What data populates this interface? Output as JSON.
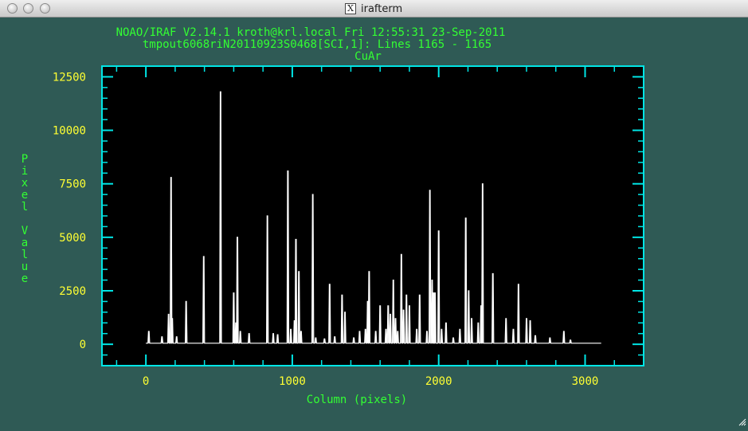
{
  "window": {
    "title": "irafterm",
    "x_icon_glyph": "X"
  },
  "plot": {
    "header_line1": "NOAO/IRAF V2.14.1 kroth@krl.local Fri 12:55:31 23-Sep-2011",
    "header_line2": "tmpout6068riN20110923S0468[SCI,1]: Lines 1165 - 1165",
    "title": "CuAr"
  },
  "colors": {
    "background": "#2f5a55",
    "plot_bg": "#000000",
    "axis": "#00e5e5",
    "label_text": "#33ff33",
    "tick_text": "#ffff33",
    "trace": "#ffffff"
  },
  "chart_data": {
    "type": "line",
    "title": "CuAr",
    "xlabel": "Column (pixels)",
    "ylabel": "Pixel Value",
    "xlim": [
      -300,
      3400
    ],
    "ylim": [
      -1000,
      13000
    ],
    "x_ticks": [
      0,
      1000,
      2000,
      3000
    ],
    "y_ticks": [
      0,
      2500,
      5000,
      7500,
      10000,
      12500
    ],
    "x_tick_labels": [
      "0",
      "1000",
      "2000",
      "3000"
    ],
    "y_tick_labels": [
      "0",
      "2500",
      "5000",
      "7500",
      "10000",
      "12500"
    ],
    "x_range": [
      0,
      3110
    ],
    "baseline": 50,
    "peaks": [
      {
        "x": 20,
        "y": 600
      },
      {
        "x": 110,
        "y": 350
      },
      {
        "x": 155,
        "y": 1400
      },
      {
        "x": 172,
        "y": 7800
      },
      {
        "x": 180,
        "y": 1200
      },
      {
        "x": 210,
        "y": 350
      },
      {
        "x": 275,
        "y": 2000
      },
      {
        "x": 395,
        "y": 4100
      },
      {
        "x": 510,
        "y": 11800
      },
      {
        "x": 600,
        "y": 2400
      },
      {
        "x": 615,
        "y": 1000
      },
      {
        "x": 625,
        "y": 5000
      },
      {
        "x": 645,
        "y": 600
      },
      {
        "x": 705,
        "y": 500
      },
      {
        "x": 830,
        "y": 6000
      },
      {
        "x": 870,
        "y": 500
      },
      {
        "x": 900,
        "y": 450
      },
      {
        "x": 970,
        "y": 8100
      },
      {
        "x": 990,
        "y": 700
      },
      {
        "x": 1015,
        "y": 1100
      },
      {
        "x": 1025,
        "y": 4900
      },
      {
        "x": 1045,
        "y": 3400
      },
      {
        "x": 1060,
        "y": 600
      },
      {
        "x": 1140,
        "y": 7000
      },
      {
        "x": 1160,
        "y": 300
      },
      {
        "x": 1220,
        "y": 250
      },
      {
        "x": 1255,
        "y": 2800
      },
      {
        "x": 1290,
        "y": 350
      },
      {
        "x": 1340,
        "y": 2300
      },
      {
        "x": 1360,
        "y": 1500
      },
      {
        "x": 1420,
        "y": 300
      },
      {
        "x": 1460,
        "y": 600
      },
      {
        "x": 1500,
        "y": 700
      },
      {
        "x": 1515,
        "y": 2000
      },
      {
        "x": 1525,
        "y": 3400
      },
      {
        "x": 1570,
        "y": 600
      },
      {
        "x": 1600,
        "y": 1800
      },
      {
        "x": 1640,
        "y": 700
      },
      {
        "x": 1655,
        "y": 1800
      },
      {
        "x": 1670,
        "y": 1400
      },
      {
        "x": 1690,
        "y": 3000
      },
      {
        "x": 1705,
        "y": 1200
      },
      {
        "x": 1720,
        "y": 600
      },
      {
        "x": 1745,
        "y": 4200
      },
      {
        "x": 1760,
        "y": 1600
      },
      {
        "x": 1780,
        "y": 2300
      },
      {
        "x": 1800,
        "y": 1800
      },
      {
        "x": 1850,
        "y": 700
      },
      {
        "x": 1870,
        "y": 2300
      },
      {
        "x": 1920,
        "y": 600
      },
      {
        "x": 1940,
        "y": 7200
      },
      {
        "x": 1955,
        "y": 3000
      },
      {
        "x": 1965,
        "y": 2400
      },
      {
        "x": 1975,
        "y": 2400
      },
      {
        "x": 2000,
        "y": 5300
      },
      {
        "x": 2020,
        "y": 700
      },
      {
        "x": 2050,
        "y": 1000
      },
      {
        "x": 2100,
        "y": 300
      },
      {
        "x": 2145,
        "y": 700
      },
      {
        "x": 2185,
        "y": 5900
      },
      {
        "x": 2205,
        "y": 2500
      },
      {
        "x": 2225,
        "y": 1200
      },
      {
        "x": 2270,
        "y": 1000
      },
      {
        "x": 2290,
        "y": 1800
      },
      {
        "x": 2300,
        "y": 7500
      },
      {
        "x": 2370,
        "y": 3300
      },
      {
        "x": 2460,
        "y": 1200
      },
      {
        "x": 2510,
        "y": 700
      },
      {
        "x": 2545,
        "y": 2800
      },
      {
        "x": 2600,
        "y": 1200
      },
      {
        "x": 2625,
        "y": 1100
      },
      {
        "x": 2660,
        "y": 400
      },
      {
        "x": 2760,
        "y": 300
      },
      {
        "x": 2855,
        "y": 600
      },
      {
        "x": 2900,
        "y": 200
      }
    ]
  }
}
